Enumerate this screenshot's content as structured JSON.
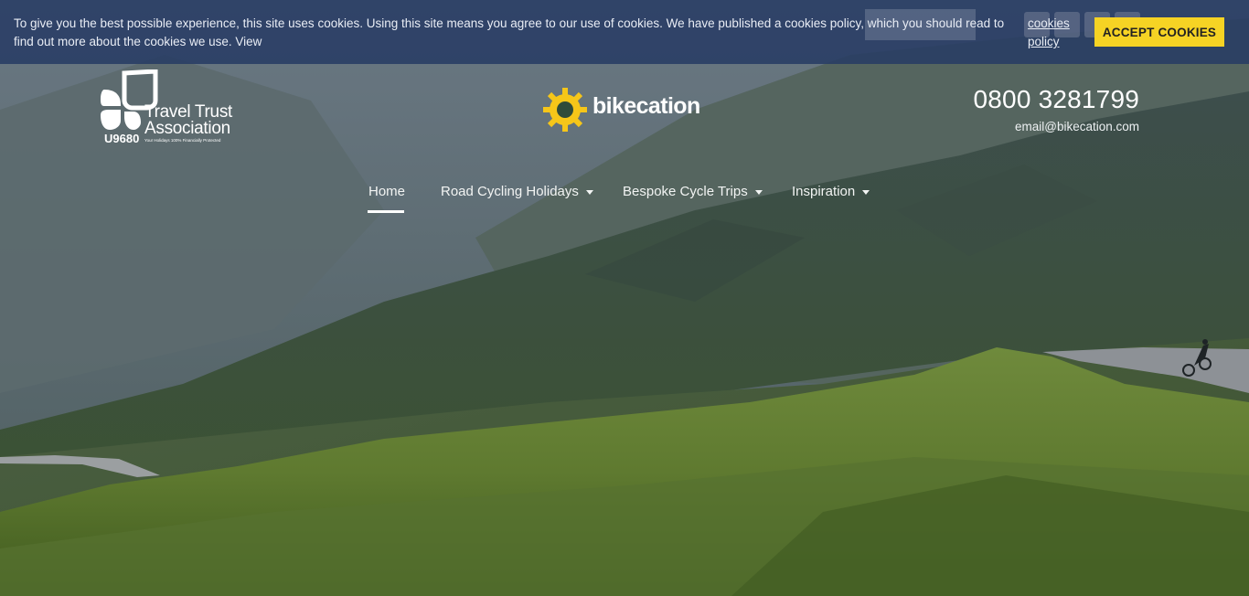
{
  "cookie_banner": {
    "message": "To give you the best possible experience, this site uses cookies. Using this site means you agree to our use of cookies. We have published a cookies policy, which you should read to find out more about the cookies we use. View",
    "policy_link": "cookies policy",
    "accept_label": "ACCEPT COOKIES"
  },
  "header": {
    "tta": {
      "line1": "Travel Trust",
      "line2": "Association",
      "code": "U9680",
      "tagline": "Your Holidays 100% Financially Protected"
    },
    "brand_name": "bikecation",
    "phone": "0800 3281799",
    "email": "email@bikecation.com"
  },
  "nav": {
    "items": [
      {
        "label": "Home"
      },
      {
        "label": "Road Cycling Holidays"
      },
      {
        "label": "Bespoke Cycle Trips"
      },
      {
        "label": "Inspiration"
      }
    ]
  },
  "colors": {
    "accent_yellow": "#f6d324",
    "banner_bg": "#283c64"
  }
}
